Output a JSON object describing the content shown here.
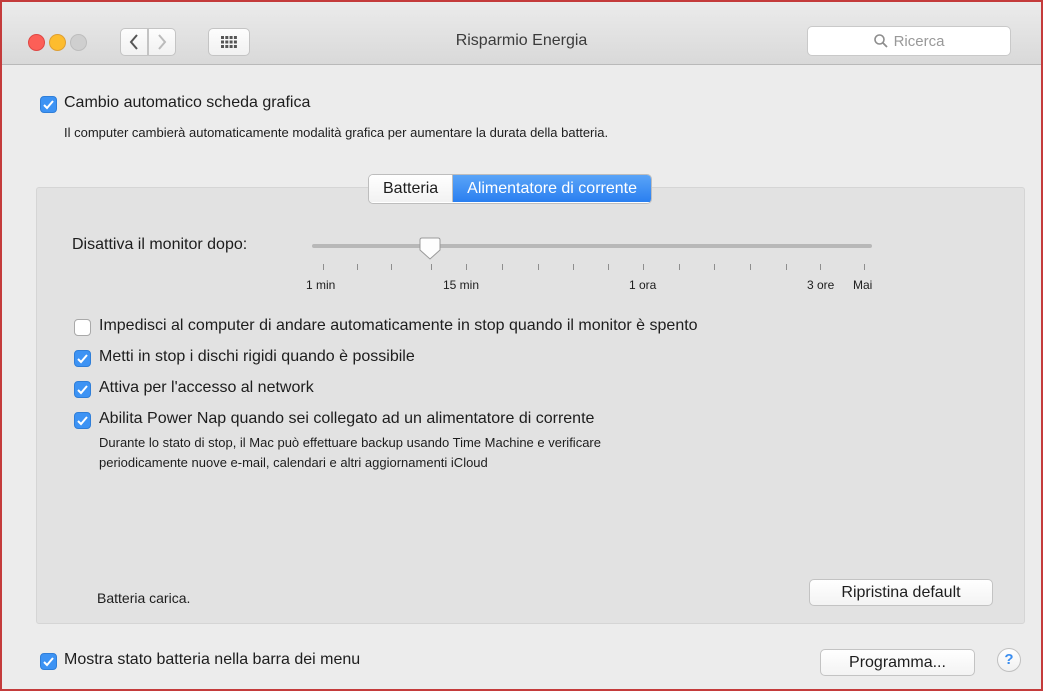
{
  "window": {
    "title": "Risparmio Energia",
    "search_placeholder": "Ricerca"
  },
  "graphics_switching": {
    "label": "Cambio automatico scheda grafica",
    "checked": true,
    "description": "Il computer cambierà automaticamente modalità grafica per aumentare la durata della batteria."
  },
  "tabs": [
    {
      "label": "Batteria",
      "active": false
    },
    {
      "label": "Alimentatore di corrente",
      "active": true
    }
  ],
  "display_sleep": {
    "label": "Disattiva il monitor dopo:",
    "value": "15 min",
    "tick_labels": [
      "1 min",
      "15 min",
      "1 ora",
      "3 ore",
      "Mai"
    ]
  },
  "options": [
    {
      "label": "Impedisci al computer di andare automaticamente in stop quando il monitor è spento",
      "checked": false
    },
    {
      "label": "Metti in stop i dischi rigidi quando è possibile",
      "checked": true
    },
    {
      "label": "Attiva per l'accesso al network",
      "checked": true
    },
    {
      "label": "Abilita Power Nap quando sei collegato ad un alimentatore di corrente",
      "checked": true,
      "description_line1": "Durante lo stato di stop, il Mac può effettuare backup usando Time Machine e verificare",
      "description_line2": "periodicamente nuove e-mail, calendari e altri aggiornamenti iCloud"
    }
  ],
  "battery_status": "Batteria carica.",
  "restore_button": "Ripristina default",
  "show_battery": {
    "label": "Mostra stato batteria nella barra dei menu",
    "checked": true
  },
  "schedule_button": "Programma...",
  "help_button": "?",
  "colors": {
    "accent": "#3d93f4",
    "frame_border": "#c43b3b"
  }
}
